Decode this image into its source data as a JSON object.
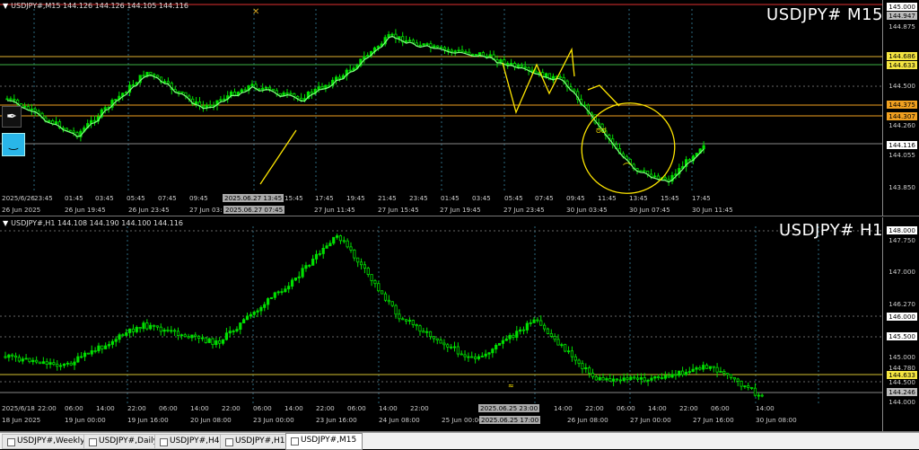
{
  "pane_m15": {
    "header": "USDJPY#,M15  144.126 144.126 144.105 144.116",
    "title": "USDJPY# M15",
    "price_labels": [
      "145.000",
      "144.947",
      "144.875",
      "144.686",
      "144.633",
      "144.500",
      "144.375",
      "144.307",
      "144.260",
      "144.116",
      "144.055",
      "143.850"
    ],
    "time_labels_row1": [
      "2025/6/26",
      "23:45",
      "01:45",
      "03:45",
      "05:45",
      "07:45",
      "09:45",
      "2025.06.27 13:45",
      "15:45",
      "17:45",
      "19:45",
      "21:45",
      "23:45",
      "01:45",
      "03:45",
      "05:45",
      "07:45",
      "09:45",
      "11:45",
      "13:45",
      "15:45",
      "17:45"
    ],
    "time_labels_row2": [
      "26 Jun 2025",
      "26 Jun 19:45",
      "26 Jun 23:45",
      "27 Jun 03:",
      "2025.06.27 07:45",
      "27 Jun 11:45",
      "27 Jun 15:45",
      "27 Jun 19:45",
      "27 Jun 23:45",
      "30 Jun 03:45",
      "30 Jun 07:45",
      "30 Jun 11:45"
    ]
  },
  "pane_h1": {
    "header": "USDJPY#,H1  144.108 144.190 144.100 144.116",
    "title": "USDJPY# H1",
    "price_labels": [
      "148.000",
      "147.750",
      "147.000",
      "146.270",
      "146.000",
      "145.500",
      "145.000",
      "144.780",
      "144.633",
      "144.500",
      "144.246",
      "144.000"
    ],
    "time_labels_row1": [
      "2025/6/18",
      "22:00",
      "06:00",
      "14:00",
      "22:00",
      "06:00",
      "14:00",
      "22:00",
      "06:00",
      "14:00",
      "22:00",
      "06:00",
      "14:00",
      "22:00",
      "2025.06.25 23:00",
      "14:00",
      "22:00",
      "06:00",
      "14:00",
      "22:00",
      "06:00",
      "14:00"
    ],
    "time_labels_row2": [
      "18 Jun 2025",
      "19 Jun 00:00",
      "19 Jun 16:00",
      "20 Jun 08:00",
      "23 Jun 00:00",
      "23 Jun 16:00",
      "24 Jun 08:00",
      "25 Jun 00:00",
      "2025.06.25 17:00",
      "26 Jun 08:00",
      "27 Jun 00:00",
      "27 Jun 16:00",
      "30 Jun 08:00"
    ]
  },
  "tabs": [
    "USDJPY#,Weekly",
    "USDJPY#,Daily",
    "USDJPY#,H4",
    "USDJPY#,H1",
    "USDJPY#,M15"
  ],
  "active_tab": "USDJPY#,M15",
  "colors": {
    "bull": "#00e000",
    "ma": "#7fff7f",
    "drawing": "#ffe600",
    "orange_level": "#f0a020",
    "green_level": "#3cb043"
  }
}
